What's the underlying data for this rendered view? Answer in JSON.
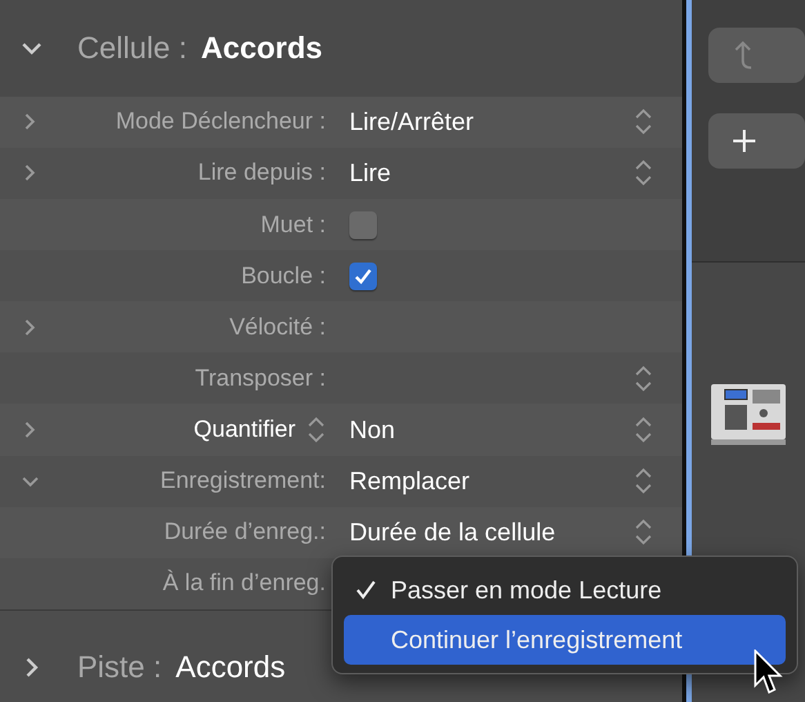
{
  "cell_header": {
    "expanded": true,
    "label": "Cellule :",
    "value": "Accords"
  },
  "rows": [
    {
      "kind": "popup",
      "expanded": false,
      "label": "Mode Déclencheur :",
      "value": "Lire/Arrêter"
    },
    {
      "kind": "popup",
      "expanded": false,
      "label": "Lire depuis :",
      "value": "Lire"
    },
    {
      "kind": "checkbox",
      "label": "Muet :",
      "checked": false
    },
    {
      "kind": "checkbox",
      "label": "Boucle :",
      "checked": true
    },
    {
      "kind": "plain",
      "expanded": false,
      "label": "Vélocité :"
    },
    {
      "kind": "stepper",
      "label": "Transposer :"
    },
    {
      "kind": "label_popup",
      "expanded": false,
      "label": "Quantifier",
      "value": "Non"
    },
    {
      "kind": "popup",
      "expanded": true,
      "label": "Enregistrement:",
      "value": "Remplacer"
    },
    {
      "kind": "popup",
      "label": "Durée d’enreg.:",
      "value": "Durée de la cellule"
    },
    {
      "kind": "plain",
      "label": "À la fin d’enreg."
    }
  ],
  "track_header": {
    "expanded": false,
    "label": "Piste :",
    "value": "Accords"
  },
  "popup_menu": [
    {
      "label": "Passer en mode Lecture",
      "checked": true,
      "selected": false
    },
    {
      "label": "Continuer l’enregistrement",
      "checked": false,
      "selected": true
    }
  ]
}
